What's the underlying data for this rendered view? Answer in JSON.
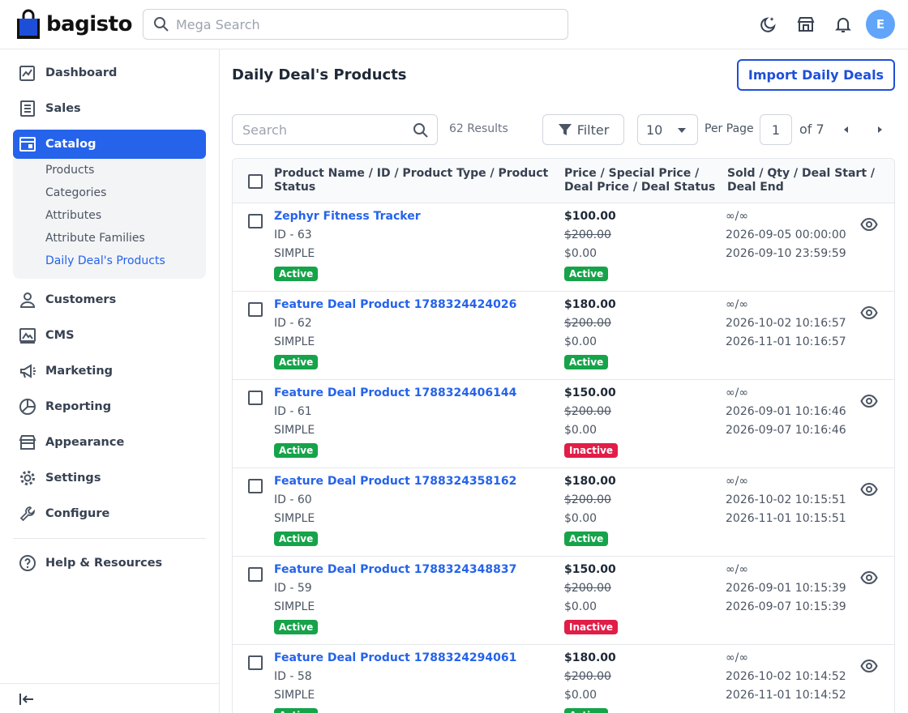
{
  "app": {
    "brand": "bagisto",
    "brand_color": "#2563eb"
  },
  "header": {
    "search_placeholder": "Mega Search",
    "avatar_letter": "E"
  },
  "sidebar": {
    "items": [
      {
        "label": "Dashboard",
        "icon": "dashboard-icon"
      },
      {
        "label": "Sales",
        "icon": "sales-icon"
      },
      {
        "label": "Catalog",
        "icon": "catalog-icon",
        "active": true
      },
      {
        "label": "Customers",
        "icon": "customers-icon"
      },
      {
        "label": "CMS",
        "icon": "cms-icon"
      },
      {
        "label": "Marketing",
        "icon": "marketing-icon"
      },
      {
        "label": "Reporting",
        "icon": "reporting-icon"
      },
      {
        "label": "Appearance",
        "icon": "appearance-icon"
      },
      {
        "label": "Settings",
        "icon": "settings-icon"
      },
      {
        "label": "Configure",
        "icon": "configure-icon"
      },
      {
        "label": "Help & Resources",
        "icon": "help-icon"
      }
    ],
    "catalog_sub": [
      {
        "label": "Products"
      },
      {
        "label": "Categories"
      },
      {
        "label": "Attributes"
      },
      {
        "label": "Attribute Families"
      },
      {
        "label": "Daily Deal's Products",
        "current": true
      }
    ]
  },
  "main": {
    "title": "Daily Deal's Products",
    "import_button": "Import Daily Deals",
    "search_placeholder": "Search",
    "results": "62 Results",
    "filter_label": "Filter",
    "per_page_value": "10",
    "per_page_label": "Per Page",
    "current_page": "1",
    "page_of": "of 7"
  },
  "table": {
    "headers": {
      "col1_line1": "Product Name / ID / Product Type / Product",
      "col1_line2": "Status",
      "col2_line1": "Price / Special Price /",
      "col2_line2": "Deal Price / Deal Status",
      "col3_line1": "Sold / Qty / Deal Start /",
      "col3_line2": "Deal End"
    },
    "rows": [
      {
        "name": "Zephyr Fitness Tracker",
        "id": "ID - 63",
        "type": "SIMPLE",
        "status": "Active",
        "price": "$100.00",
        "special_price": "$200.00",
        "deal_price": "$0.00",
        "deal_status": "Active",
        "sold_qty": "∞/∞",
        "deal_start": "2026-09-05 00:00:00",
        "deal_end": "2026-09-10 23:59:59"
      },
      {
        "name": "Feature Deal Product 1788324424026",
        "id": "ID - 62",
        "type": "SIMPLE",
        "status": "Active",
        "price": "$180.00",
        "special_price": "$200.00",
        "deal_price": "$0.00",
        "deal_status": "Active",
        "sold_qty": "∞/∞",
        "deal_start": "2026-10-02 10:16:57",
        "deal_end": "2026-11-01 10:16:57"
      },
      {
        "name": "Feature Deal Product 1788324406144",
        "id": "ID - 61",
        "type": "SIMPLE",
        "status": "Active",
        "price": "$150.00",
        "special_price": "$200.00",
        "deal_price": "$0.00",
        "deal_status": "Inactive",
        "sold_qty": "∞/∞",
        "deal_start": "2026-09-01 10:16:46",
        "deal_end": "2026-09-07 10:16:46"
      },
      {
        "name": "Feature Deal Product 1788324358162",
        "id": "ID - 60",
        "type": "SIMPLE",
        "status": "Active",
        "price": "$180.00",
        "special_price": "$200.00",
        "deal_price": "$0.00",
        "deal_status": "Active",
        "sold_qty": "∞/∞",
        "deal_start": "2026-10-02 10:15:51",
        "deal_end": "2026-11-01 10:15:51"
      },
      {
        "name": "Feature Deal Product 1788324348837",
        "id": "ID - 59",
        "type": "SIMPLE",
        "status": "Active",
        "price": "$150.00",
        "special_price": "$200.00",
        "deal_price": "$0.00",
        "deal_status": "Inactive",
        "sold_qty": "∞/∞",
        "deal_start": "2026-09-01 10:15:39",
        "deal_end": "2026-09-07 10:15:39"
      },
      {
        "name": "Feature Deal Product 1788324294061",
        "id": "ID - 58",
        "type": "SIMPLE",
        "status": "Active",
        "price": "$180.00",
        "special_price": "$200.00",
        "deal_price": "$0.00",
        "deal_status": "Active",
        "sold_qty": "∞/∞",
        "deal_start": "2026-10-02 10:14:52",
        "deal_end": "2026-11-01 10:14:52"
      }
    ]
  },
  "colors": {
    "active": "#16a34a",
    "inactive": "#e11d48",
    "link": "#2563eb"
  }
}
